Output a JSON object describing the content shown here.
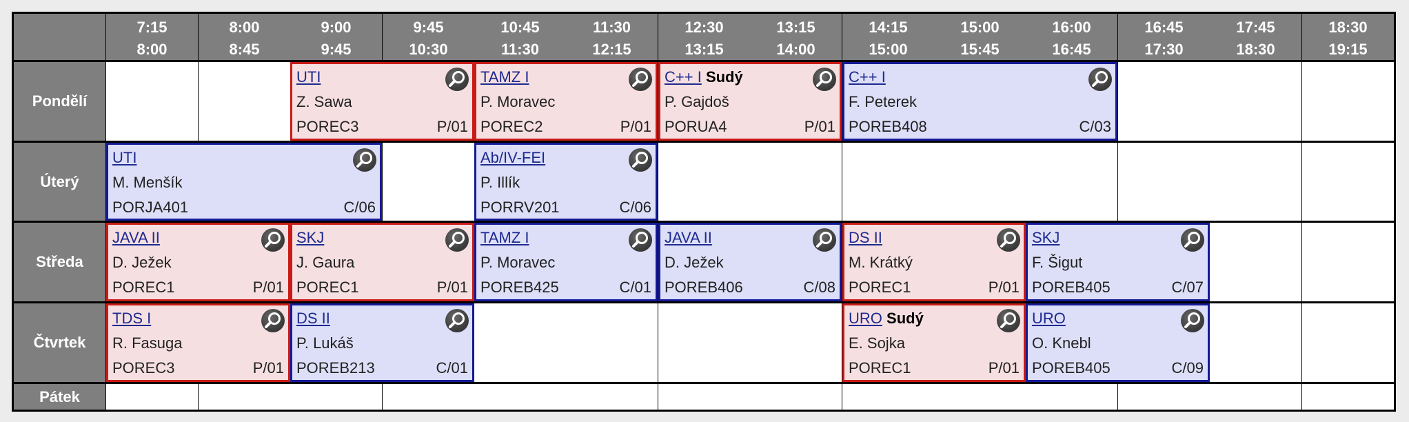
{
  "times": [
    {
      "start": "7:15",
      "end": "8:00"
    },
    {
      "start": "8:00",
      "end": "8:45"
    },
    {
      "start": "9:00",
      "end": "9:45"
    },
    {
      "start": "9:45",
      "end": "10:30"
    },
    {
      "start": "10:45",
      "end": "11:30"
    },
    {
      "start": "11:30",
      "end": "12:15"
    },
    {
      "start": "12:30",
      "end": "13:15"
    },
    {
      "start": "13:15",
      "end": "14:00"
    },
    {
      "start": "14:15",
      "end": "15:00"
    },
    {
      "start": "15:00",
      "end": "15:45"
    },
    {
      "start": "16:00",
      "end": "16:45"
    },
    {
      "start": "16:45",
      "end": "17:30"
    },
    {
      "start": "17:45",
      "end": "18:30"
    },
    {
      "start": "18:30",
      "end": "19:15"
    }
  ],
  "days": [
    "Pondělí",
    "Úterý",
    "Středa",
    "Čtvrtek",
    "Pátek"
  ],
  "colors": {
    "lecture_bg": "#f6dfe1",
    "lecture_border": "#c81b17",
    "exercise_bg": "#dddff8",
    "exercise_border": "#141a96",
    "header_bg": "#7f7f7f"
  },
  "lessons": [
    {
      "day": 0,
      "start": 2,
      "span": 2,
      "type": "lecture",
      "course": "UTI",
      "note": "",
      "teacher": "Z. Sawa",
      "room": "POREC3",
      "group": "P/01"
    },
    {
      "day": 0,
      "start": 4,
      "span": 2,
      "type": "lecture",
      "course": "TAMZ I",
      "note": "",
      "teacher": "P. Moravec",
      "room": "POREC2",
      "group": "P/01"
    },
    {
      "day": 0,
      "start": 6,
      "span": 2,
      "type": "lecture",
      "course": "C++ I",
      "note": "Sudý",
      "teacher": "P. Gajdoš",
      "room": "PORUA4",
      "group": "P/01"
    },
    {
      "day": 0,
      "start": 8,
      "span": 3,
      "type": "exercise",
      "course": "C++ I",
      "note": "",
      "teacher": "F. Peterek",
      "room": "POREB408",
      "group": "C/03"
    },
    {
      "day": 1,
      "start": 0,
      "span": 3,
      "type": "exercise",
      "course": "UTI",
      "note": "",
      "teacher": "M. Menšík",
      "room": "PORJA401",
      "group": "C/06"
    },
    {
      "day": 1,
      "start": 4,
      "span": 2,
      "type": "exercise",
      "course": "Ab/IV-FEI",
      "note": "",
      "teacher": "P. Illík",
      "room": "PORRV201",
      "group": "C/06"
    },
    {
      "day": 2,
      "start": 0,
      "span": 2,
      "type": "lecture",
      "course": "JAVA II",
      "note": "",
      "teacher": "D. Ježek",
      "room": "POREC1",
      "group": "P/01"
    },
    {
      "day": 2,
      "start": 2,
      "span": 2,
      "type": "lecture",
      "course": "SKJ",
      "note": "",
      "teacher": "J. Gaura",
      "room": "POREC1",
      "group": "P/01"
    },
    {
      "day": 2,
      "start": 4,
      "span": 2,
      "type": "exercise",
      "course": "TAMZ I",
      "note": "",
      "teacher": "P. Moravec",
      "room": "POREB425",
      "group": "C/01"
    },
    {
      "day": 2,
      "start": 6,
      "span": 2,
      "type": "exercise",
      "course": "JAVA II",
      "note": "",
      "teacher": "D. Ježek",
      "room": "POREB406",
      "group": "C/08"
    },
    {
      "day": 2,
      "start": 8,
      "span": 2,
      "type": "lecture",
      "course": "DS II",
      "note": "",
      "teacher": "M. Krátký",
      "room": "POREC1",
      "group": "P/01"
    },
    {
      "day": 2,
      "start": 10,
      "span": 2,
      "type": "exercise",
      "course": "SKJ",
      "note": "",
      "teacher": "F. Šigut",
      "room": "POREB405",
      "group": "C/07"
    },
    {
      "day": 3,
      "start": 0,
      "span": 2,
      "type": "lecture",
      "course": "TDS I",
      "note": "",
      "teacher": "R. Fasuga",
      "room": "POREC3",
      "group": "P/01"
    },
    {
      "day": 3,
      "start": 2,
      "span": 2,
      "type": "exercise",
      "course": "DS II",
      "note": "",
      "teacher": "P. Lukáš",
      "room": "POREB213",
      "group": "C/01"
    },
    {
      "day": 3,
      "start": 8,
      "span": 2,
      "type": "lecture",
      "course": "URO",
      "note": "Sudý",
      "teacher": "E. Sojka",
      "room": "POREC1",
      "group": "P/01"
    },
    {
      "day": 3,
      "start": 10,
      "span": 2,
      "type": "exercise",
      "course": "URO",
      "note": "",
      "teacher": "O. Knebl",
      "room": "POREB405",
      "group": "C/09"
    }
  ]
}
